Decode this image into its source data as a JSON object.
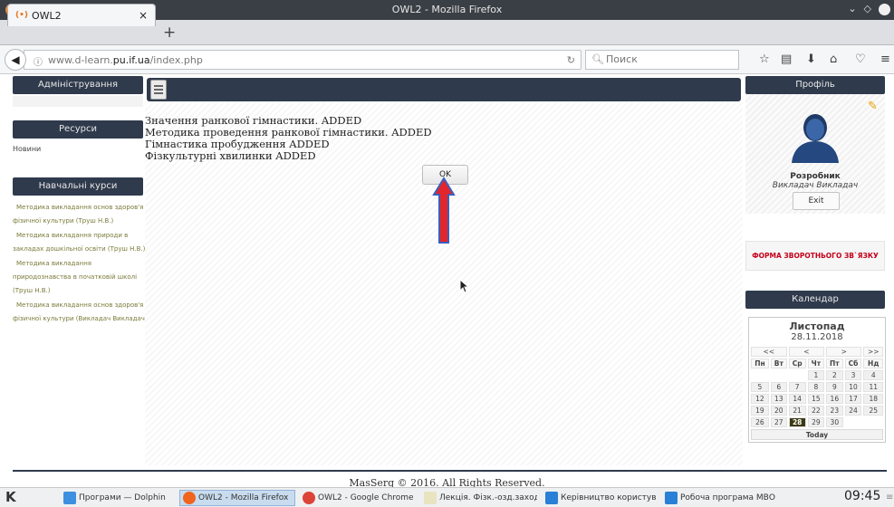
{
  "window": {
    "title": "OWL2 - Mozilla Firefox",
    "controls": [
      "chevron-down-icon",
      "restore-icon",
      "close-icon"
    ]
  },
  "tabbar": {
    "tab_title": "OWL2",
    "close": "×",
    "new_tab": "+"
  },
  "navbar": {
    "url_plain": "www.d-learn.",
    "url_domain": "pu.if.ua",
    "url_path": "/index.php",
    "search_placeholder": "Поиск"
  },
  "left": {
    "admin_header": "Адміністрування",
    "resources_header": "Ресурси",
    "news_link": "Новини",
    "courses_header": "Навчальні курси",
    "courses_lines": [
      "Методика викладання основ здоров'я і",
      "фізичної культури (Труш Н.В.)",
      "Методика викладання природи в",
      "закладах дошкільної освіти (Труш Н.В.)",
      "Методика викладання",
      "природознавства в початковій школі",
      "(Труш Н.В.)",
      "Методика викладання основ здоров'я і",
      "фізичної культури (Викладач Викладач)"
    ]
  },
  "main": {
    "messages": [
      "Значення ранкової гімнастики. ADDED",
      "Методика проведення ранкової гімнастики. ADDED",
      "Гімнастика пробудження ADDED",
      "Фізкультурні хвилинки ADDED"
    ],
    "ok_label": "OK"
  },
  "right": {
    "profile_header": "Профіль",
    "profile_name": "Розробник",
    "profile_role": "Викладач  Викладач",
    "exit_label": "Exit",
    "feedback_label": "ФОРМА ЗВОРОТНЬОГО ЗВ`ЯЗКУ",
    "calendar_header": "Календар",
    "calendar": {
      "month": "Листопад",
      "date": "28.11.2018",
      "nav": [
        "<<",
        "<",
        ">",
        ">>"
      ],
      "weekdays": [
        "Пн",
        "Вт",
        "Ср",
        "Чт",
        "Пт",
        "Сб",
        "Нд"
      ],
      "weeks": [
        [
          "",
          "",
          "",
          "1",
          "2",
          "3",
          "4"
        ],
        [
          "5",
          "6",
          "7",
          "8",
          "9",
          "10",
          "11"
        ],
        [
          "12",
          "13",
          "14",
          "15",
          "16",
          "17",
          "18"
        ],
        [
          "19",
          "20",
          "21",
          "22",
          "23",
          "24",
          "25"
        ],
        [
          "26",
          "27",
          "28",
          "29",
          "30",
          "",
          ""
        ]
      ],
      "selected_day": "28",
      "today_label": "Today"
    }
  },
  "footer": {
    "text": "MasSerg © 2016. All Rights Reserved."
  },
  "taskbar": {
    "launcher": "K",
    "tasks": [
      {
        "label": "Програми — Dolphin",
        "icon": "folder-icon",
        "color": "#3d8fe0"
      },
      {
        "label": "OWL2 - Mozilla Firefox",
        "icon": "firefox-icon",
        "color": "#f0641e"
      },
      {
        "label": "OWL2 - Google Chrome",
        "icon": "chrome-icon",
        "color": "#db4437"
      },
      {
        "label": "Лекція. Фізк.-озд.заход",
        "icon": "document-icon",
        "color": "#e8e4c0"
      },
      {
        "label": "Керівництво користува",
        "icon": "document-icon",
        "color": "#2a7fd6"
      },
      {
        "label": "Робоча програма МВО",
        "icon": "document-icon",
        "color": "#2a7fd6"
      }
    ],
    "clock": "09:45"
  }
}
